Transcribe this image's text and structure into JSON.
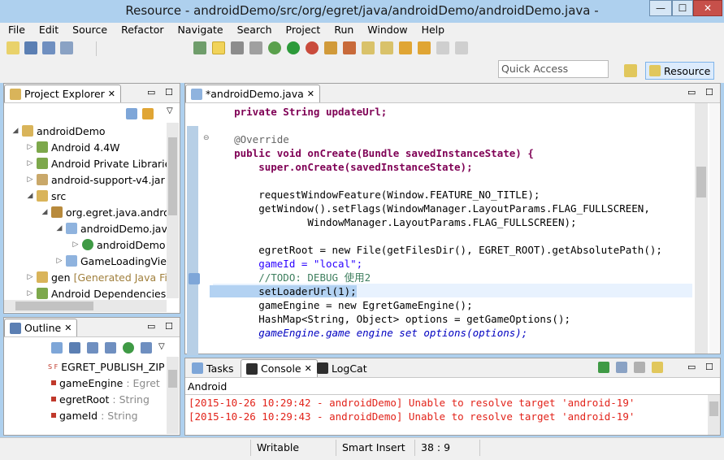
{
  "window": {
    "title": "Resource - androidDemo/src/org/egret/java/androidDemo/androidDemo.java -",
    "minimize": "—",
    "maximize": "☐",
    "close": "✕"
  },
  "menu": [
    "File",
    "Edit",
    "Source",
    "Refactor",
    "Navigate",
    "Search",
    "Project",
    "Run",
    "Window",
    "Help"
  ],
  "toolbar": {
    "quick_access_placeholder": "Quick Access",
    "perspective_label": "Resource"
  },
  "project_explorer": {
    "tab_label": "Project Explorer",
    "tree": [
      {
        "label": "androidDemo",
        "extra": ""
      },
      {
        "label": "Android 4.4W",
        "extra": ""
      },
      {
        "label": "Android Private Librarie",
        "extra": ""
      },
      {
        "label": "android-support-v4.jar",
        "extra": ""
      },
      {
        "label": "src",
        "extra": ""
      },
      {
        "label": "org.egret.java.andro",
        "extra": ""
      },
      {
        "label": "androidDemo.jav",
        "extra": ""
      },
      {
        "label": "androidDemo",
        "extra": ""
      },
      {
        "label": "GameLoadingVie",
        "extra": ""
      },
      {
        "label": "gen",
        "extra": "[Generated Java Fi"
      },
      {
        "label": "Android Dependencies",
        "extra": ""
      }
    ]
  },
  "outline": {
    "tab_label": "Outline",
    "items": [
      {
        "name": "EGRET_PUBLISH_ZIP",
        "type": "",
        "badge": "S F"
      },
      {
        "name": "gameEngine",
        "type": " : Egret",
        "badge": ""
      },
      {
        "name": "egretRoot",
        "type": " : String",
        "badge": ""
      },
      {
        "name": "gameId",
        "type": " : String",
        "badge": ""
      }
    ]
  },
  "editor": {
    "tab_label": "*androidDemo.java",
    "lines": [
      "    private String updateUrl;",
      "",
      "    @Override",
      "    public void onCreate(Bundle savedInstanceState) {",
      "        super.onCreate(savedInstanceState);",
      "",
      "        requestWindowFeature(Window.FEATURE_NO_TITLE);",
      "        getWindow().setFlags(WindowManager.LayoutParams.FLAG_FULLSCREEN,",
      "                WindowManager.LayoutParams.FLAG_FULLSCREEN);",
      "",
      "        egretRoot = new File(getFilesDir(), EGRET_ROOT).getAbsolutePath();",
      "        gameId = \"local\";",
      "        //TODO: DEBUG 使用2",
      "        setLoaderUrl(1);",
      "        gameEngine = new EgretGameEngine();",
      "        HashMap<String, Object> options = getGameOptions();",
      "        gameEngine.game engine set options(options);"
    ]
  },
  "bottom_panel": {
    "tabs": [
      "Tasks",
      "Console",
      "LogCat"
    ],
    "console_title": "Android",
    "console_lines": [
      "[2015-10-26 10:29:42 - androidDemo] Unable to resolve target 'android-19'",
      "[2015-10-26 10:29:43 - androidDemo] Unable to resolve target 'android-19'"
    ]
  },
  "status": {
    "writable": "Writable",
    "insert_mode": "Smart Insert",
    "position": "38 : 9"
  },
  "colors": {
    "accent": "#aed0ee",
    "keyword": "#7f0055",
    "string": "#2a00ff",
    "field": "#0000c0",
    "comment": "#3f7f5f",
    "console_error": "#e2231a"
  }
}
